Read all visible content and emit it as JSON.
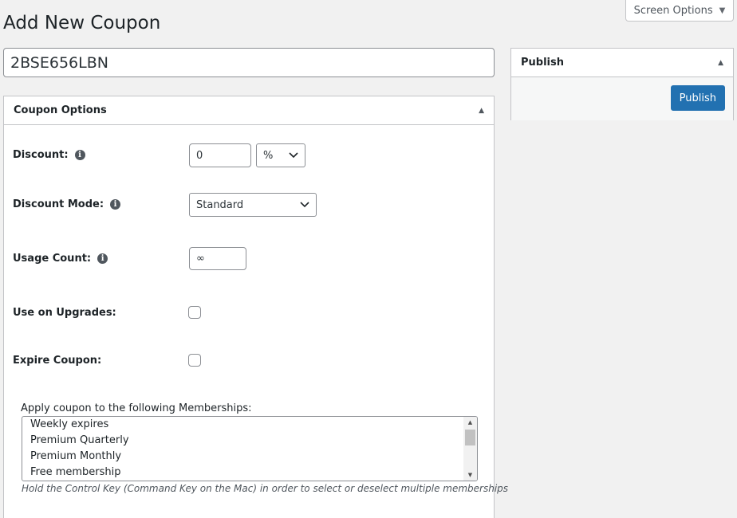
{
  "screen_options": {
    "label": "Screen Options"
  },
  "page": {
    "title": "Add New Coupon"
  },
  "coupon_title": {
    "value": "2BSE656LBN"
  },
  "coupon_options": {
    "heading": "Coupon Options",
    "discount": {
      "label": "Discount:",
      "value": "0",
      "type": "%"
    },
    "discount_mode": {
      "label": "Discount Mode:",
      "value": "Standard"
    },
    "usage_count": {
      "label": "Usage Count:",
      "value": "∞"
    },
    "use_on_upgrades": {
      "label": "Use on Upgrades:",
      "checked": false
    },
    "expire_coupon": {
      "label": "Expire Coupon:",
      "checked": false
    },
    "memberships": {
      "label": "Apply coupon to the following Memberships:",
      "items": [
        "Weekly expires",
        "Premium Quarterly",
        "Premium Monthly",
        "Free membership"
      ],
      "hint": "Hold the Control Key (Command Key on the Mac) in order to select or deselect multiple memberships"
    }
  },
  "publish": {
    "heading": "Publish",
    "button_label": "Publish"
  },
  "icons": {
    "info": "info-icon",
    "toggle": "triangle-up-icon",
    "dropdown": "chevron-down-icon",
    "screen_options": "triangle-down-icon"
  },
  "colors": {
    "primary": "#2271b1",
    "background": "#f1f1f1",
    "border": "#c3c4c7"
  }
}
